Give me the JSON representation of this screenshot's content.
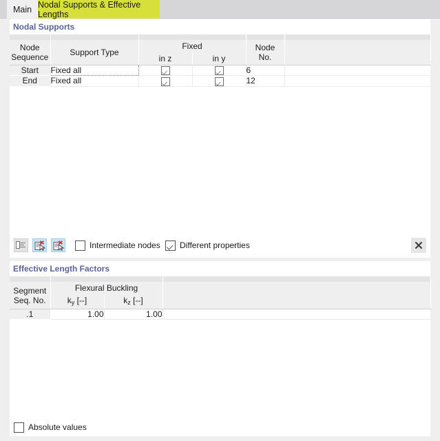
{
  "tabs": [
    {
      "label": "Main",
      "active": false
    },
    {
      "label": "Nodal Supports & Effective Lengths",
      "active": true
    }
  ],
  "colors": {
    "tab_active_bg": "#d7e03a",
    "section_title": "#5b6397",
    "panel_bg": "#ffffff",
    "window_bg": "#efefef",
    "header_cell_bg": "#efefef",
    "icon_selected_bg": "#cce4f7",
    "icon_accent_red": "#d0322e"
  },
  "nodal_supports": {
    "title": "Nodal Supports",
    "headers": {
      "node_sequence": "Node\nSequence",
      "node_sequence_l1": "Node",
      "node_sequence_l2": "Sequence",
      "support_type": "Support Type",
      "fixed_group": "Fixed",
      "fixed_in_z": "in z",
      "fixed_in_y": "in y",
      "node_no_l1": "Node",
      "node_no_l2": "No.",
      "spare": ""
    },
    "rows": [
      {
        "sequence": "Start",
        "support_type": "Fixed all",
        "fixed_in_z": true,
        "fixed_in_y": true,
        "node_no": "6",
        "focused": true
      },
      {
        "sequence": "End",
        "support_type": "Fixed all",
        "fixed_in_z": true,
        "fixed_in_y": true,
        "node_no": "12",
        "focused": false
      }
    ],
    "toolbar": {
      "buttons": [
        {
          "name": "indent-list-icon",
          "state": "disabled"
        },
        {
          "name": "delete-document-icon-1",
          "state": "selected"
        },
        {
          "name": "delete-document-icon-2",
          "state": "selected"
        }
      ],
      "intermediate_nodes": {
        "label": "Intermediate nodes",
        "checked": false
      },
      "different_properties": {
        "label": "Different properties",
        "checked": true
      },
      "close_label": "✕"
    }
  },
  "effective_lengths": {
    "title": "Effective Length Factors",
    "headers": {
      "segment_l1": "Segment",
      "segment_l2": "Seq. No.",
      "flexural_buckling": "Flexural Buckling",
      "ky_base": "k",
      "ky_sub": "y",
      "ky_unit": " [--]",
      "kz_base": "k",
      "kz_sub": "z",
      "kz_unit": " [--]",
      "spare": ""
    },
    "rows": [
      {
        "segment": ".1",
        "ky": "1.00",
        "kz": "1.00"
      }
    ],
    "absolute_values": {
      "label": "Absolute values",
      "checked": false
    }
  }
}
